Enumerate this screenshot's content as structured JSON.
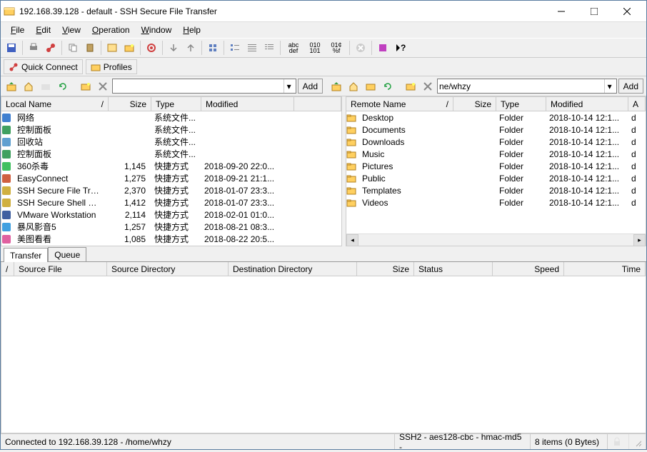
{
  "window": {
    "title": "192.168.39.128 - default - SSH Secure File Transfer"
  },
  "menu": {
    "file": "File",
    "edit": "Edit",
    "view": "View",
    "operation": "Operation",
    "window": "Window",
    "help": "Help"
  },
  "quickbar": {
    "quick_connect": "Quick Connect",
    "profiles": "Profiles"
  },
  "nav": {
    "add": "Add",
    "remote_path": "ne/whzy",
    "local_path": ""
  },
  "local": {
    "headers": {
      "name": "Local Name",
      "size": "Size",
      "type": "Type",
      "modified": "Modified"
    },
    "rows": [
      {
        "icon": "network-icon",
        "name": "网络",
        "size": "",
        "type": "系统文件...",
        "modified": ""
      },
      {
        "icon": "panel-icon",
        "name": "控制面板",
        "size": "",
        "type": "系统文件...",
        "modified": ""
      },
      {
        "icon": "recycle-icon",
        "name": "回收站",
        "size": "",
        "type": "系统文件...",
        "modified": ""
      },
      {
        "icon": "panel-icon",
        "name": "控制面板",
        "size": "",
        "type": "系统文件...",
        "modified": ""
      },
      {
        "icon": "shield-icon",
        "name": "360杀毒",
        "size": "1,145",
        "type": "快捷方式",
        "modified": "2018-09-20 22:0..."
      },
      {
        "icon": "easy-icon",
        "name": "EasyConnect",
        "size": "1,275",
        "type": "快捷方式",
        "modified": "2018-09-21 21:1..."
      },
      {
        "icon": "ssh-icon",
        "name": "SSH Secure File Transfe...",
        "size": "2,370",
        "type": "快捷方式",
        "modified": "2018-01-07 23:3..."
      },
      {
        "icon": "ssh-icon",
        "name": "SSH Secure Shell Client",
        "size": "1,412",
        "type": "快捷方式",
        "modified": "2018-01-07 23:3..."
      },
      {
        "icon": "vmware-icon",
        "name": "VMware Workstation",
        "size": "2,114",
        "type": "快捷方式",
        "modified": "2018-02-01 01:0..."
      },
      {
        "icon": "baofeng-icon",
        "name": "暴风影音5",
        "size": "1,257",
        "type": "快捷方式",
        "modified": "2018-08-21 08:3..."
      },
      {
        "icon": "meitu-icon",
        "name": "美图看看",
        "size": "1,085",
        "type": "快捷方式",
        "modified": "2018-08-22 20:5..."
      }
    ]
  },
  "remote": {
    "headers": {
      "name": "Remote Name",
      "size": "Size",
      "type": "Type",
      "modified": "Modified",
      "attr": "A"
    },
    "rows": [
      {
        "name": "Desktop",
        "size": "",
        "type": "Folder",
        "modified": "2018-10-14 12:1...",
        "attr": "d"
      },
      {
        "name": "Documents",
        "size": "",
        "type": "Folder",
        "modified": "2018-10-14 12:1...",
        "attr": "d"
      },
      {
        "name": "Downloads",
        "size": "",
        "type": "Folder",
        "modified": "2018-10-14 12:1...",
        "attr": "d"
      },
      {
        "name": "Music",
        "size": "",
        "type": "Folder",
        "modified": "2018-10-14 12:1...",
        "attr": "d"
      },
      {
        "name": "Pictures",
        "size": "",
        "type": "Folder",
        "modified": "2018-10-14 12:1...",
        "attr": "d"
      },
      {
        "name": "Public",
        "size": "",
        "type": "Folder",
        "modified": "2018-10-14 12:1...",
        "attr": "d"
      },
      {
        "name": "Templates",
        "size": "",
        "type": "Folder",
        "modified": "2018-10-14 12:1...",
        "attr": "d"
      },
      {
        "name": "Videos",
        "size": "",
        "type": "Folder",
        "modified": "2018-10-14 12:1...",
        "attr": "d"
      }
    ]
  },
  "tabs": {
    "transfer": "Transfer",
    "queue": "Queue"
  },
  "transfer_headers": {
    "slash": "/",
    "source_file": "Source File",
    "source_dir": "Source Directory",
    "dest_dir": "Destination Directory",
    "size": "Size",
    "status": "Status",
    "speed": "Speed",
    "time": "Time"
  },
  "status": {
    "connected": "Connected to 192.168.39.128 - /home/whzy",
    "cipher": "SSH2 - aes128-cbc - hmac-md5 - ",
    "items": "8 items (0 Bytes)"
  }
}
